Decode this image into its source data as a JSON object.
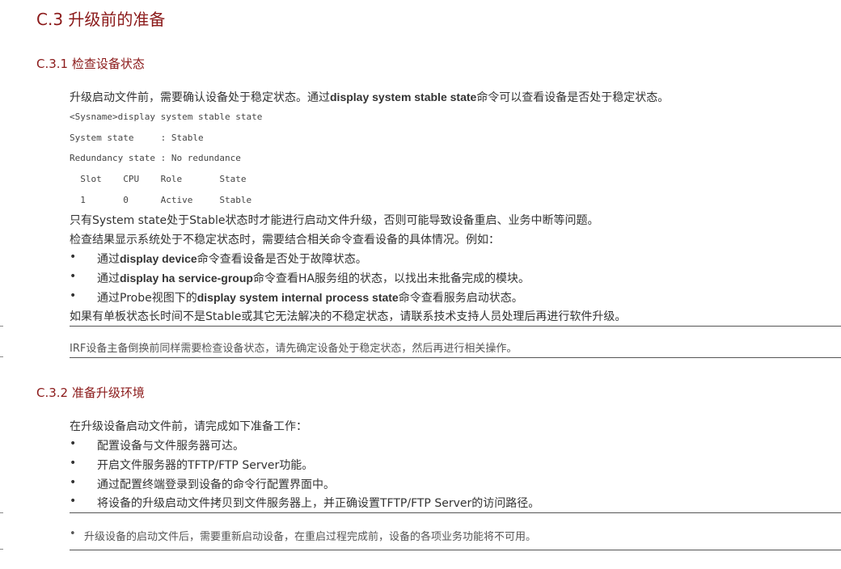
{
  "section_title": "C.3 升级前的准备",
  "s1": {
    "title": "C.3.1 检查设备状态",
    "intro_pre": "升级启动文件前，需要确认设备处于稳定状态。通过",
    "intro_cmd": "display system stable state",
    "intro_post": "命令可以查看设备是否处于稳定状态。",
    "code_lines": [
      "<Sysname>display system stable state",
      "System state     : Stable",
      "Redundancy state : No redundance",
      "  Slot    CPU    Role       State",
      "  1       0      Active     Stable"
    ],
    "para1": "只有System state处于Stable状态时才能进行启动文件升级，否则可能导致设备重启、业务中断等问题。",
    "para2": "检查结果显示系统处于不稳定状态时，需要结合相关命令查看设备的具体情况。例如：",
    "bullets": [
      {
        "pre": "通过",
        "cmd": "display device",
        "post": "命令查看设备是否处于故障状态。"
      },
      {
        "pre": "通过",
        "cmd": "display ha service-group",
        "post": "命令查看HA服务组的状态，以找出未批备完成的模块。"
      },
      {
        "pre": "通过Probe视图下的",
        "cmd": "display system internal process state",
        "post": "命令查看服务启动状态。"
      }
    ],
    "para3": "如果有单板状态长时间不是Stable或其它无法解决的不稳定状态，请联系技术支持人员处理后再进行软件升级。",
    "note": "IRF设备主备倒换前同样需要检查设备状态，请先确定设备处于稳定状态，然后再进行相关操作。"
  },
  "s2": {
    "title": "C.3.2 准备升级环境",
    "intro": "在升级设备启动文件前，请完成如下准备工作：",
    "bullets": [
      "配置设备与文件服务器可达。",
      "开启文件服务器的TFTP/FTP Server功能。",
      "通过配置终端登录到设备的命令行配置界面中。",
      "将设备的升级启动文件拷贝到文件服务器上，并正确设置TFTP/FTP Server的访问路径。"
    ],
    "note": "升级设备的启动文件后，需要重新启动设备，在重启过程完成前，设备的各项业务功能将不可用。"
  },
  "bullet_glyph": "•"
}
